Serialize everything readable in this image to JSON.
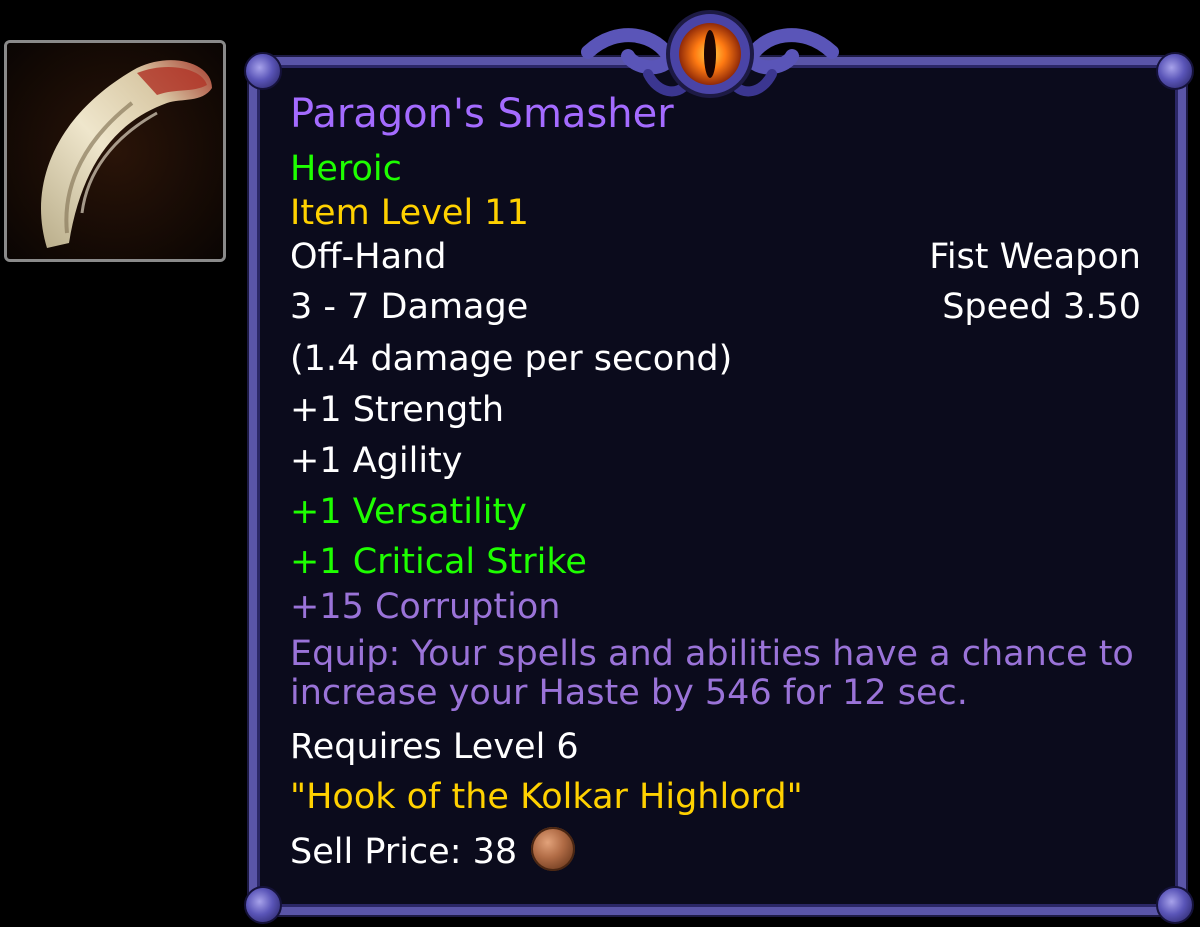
{
  "item": {
    "name": "Paragon's Smasher",
    "quality": "Heroic",
    "item_level": "Item Level 11",
    "slot": "Off-Hand",
    "type": "Fist Weapon",
    "damage": "3 - 7 Damage",
    "speed": "Speed 3.50",
    "dps": "(1.4 damage per second)",
    "stats": [
      "+1 Strength",
      "+1 Agility"
    ],
    "secondary_stats": [
      "+1 Versatility",
      "+1 Critical Strike"
    ],
    "corruption": "+15 Corruption",
    "equip_effect": "Equip: Your spells and abilities have a chance to increase your Haste by 546 for 12 sec.",
    "requires": "Requires Level 6",
    "flavor_text": "\"Hook of the Kolkar Highlord\"",
    "sell_price_label": "Sell Price: 38",
    "coin_icon": "copper-coin-icon",
    "item_icon": "claw-hook-icon"
  },
  "colors": {
    "name": "#a46bff",
    "heroic": "#1eff00",
    "item_level": "#ffd100",
    "corruption": "#9a73d8",
    "border": "#5a55a8",
    "background": "#0b0b1c"
  }
}
